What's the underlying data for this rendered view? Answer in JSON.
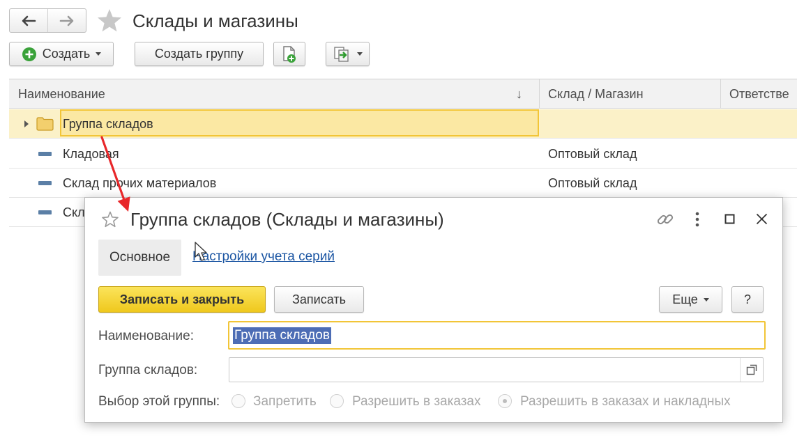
{
  "window": {
    "title": "Склады и магазины",
    "nav": {
      "back_icon": "back-arrow-icon",
      "forward_icon": "forward-arrow-icon"
    },
    "favorite_icon": "star-icon"
  },
  "toolbar": {
    "create_label": "Создать",
    "create_group_label": "Создать группу",
    "copy_icon": "add-document-icon",
    "more_icon": "related-documents-icon"
  },
  "table": {
    "columns": [
      "Наименование",
      "Склад / Магазин",
      "Ответстве"
    ],
    "sort_indicator": "↓",
    "rows": [
      {
        "name": "Группа складов",
        "type": "",
        "kind": "group",
        "selected": true
      },
      {
        "name": "Кладовая",
        "type": "Оптовый склад",
        "kind": "item"
      },
      {
        "name": "Склад прочих материалов",
        "type": "Оптовый склад",
        "kind": "item"
      },
      {
        "name": "Скл",
        "type": "",
        "kind": "item"
      }
    ]
  },
  "modal": {
    "title": "Группа складов (Склады и магазины)",
    "tabs": [
      "Основное",
      "Настройки учета серий"
    ],
    "buttons": {
      "save_close": "Записать и закрыть",
      "save": "Записать",
      "more": "Еще",
      "help": "?"
    },
    "fields": {
      "name_label": "Наименование:",
      "name_value": "Группа складов",
      "group_label": "Группа складов:",
      "group_value": "",
      "choice_label": "Выбор этой группы:"
    },
    "radio_options": [
      "Запретить",
      "Разрешить в заказах",
      "Разрешить в заказах и накладных"
    ],
    "radio_selected_index": 2
  },
  "colors": {
    "accent_yellow": "#f2c537",
    "selection_row": "#fbf1c8",
    "text_selection": "#4d6db5",
    "link": "#1c56a3",
    "annotation_arrow": "#e8272a",
    "create_icon_green": "#3aa23a"
  }
}
